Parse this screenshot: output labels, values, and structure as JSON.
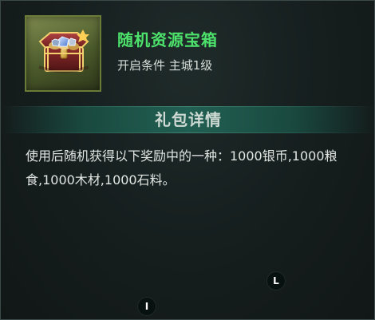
{
  "item": {
    "name": "随机资源宝箱",
    "condition": "开启条件 主城1级",
    "icon": "treasure-chest-icon"
  },
  "section": {
    "title": "礼包详情"
  },
  "description": "使用后随机获得以下奖励中的一种：1000银币,1000粮食,1000木材,1000石料。",
  "badges": {
    "l": "L",
    "i": "I"
  },
  "colors": {
    "title": "#4de26b",
    "header": "#226758",
    "text": "#e1e6e3",
    "frame": "#6a7b37"
  }
}
